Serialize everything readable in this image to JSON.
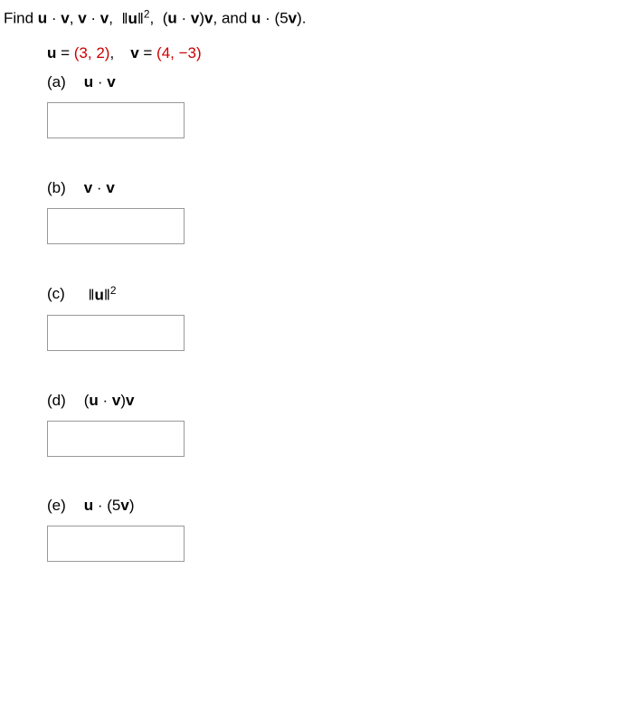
{
  "intro": {
    "prefix": "Find ",
    "e1_a": "u",
    "dot": " · ",
    "e1_b": "v",
    "comma": ", ",
    "e2_a": "v",
    "e2_b": "v",
    "e3_open": "‖",
    "e3_u": "u",
    "e3_close": "‖",
    "e3_exp": "2",
    "e4_open": "(",
    "e4_u": "u",
    "e4_v1": "v",
    "e4_close": ")",
    "e4_v2": "v",
    "and": ", and ",
    "e5_u": "u",
    "e5_open": " · (5",
    "e5_v": "v",
    "e5_close": ").",
    "period": ""
  },
  "given": {
    "u_lhs": "u",
    "u_eq": " = ",
    "u_rhs": "(3, 2)",
    "sep": ",",
    "v_lhs": "v",
    "v_eq": " = ",
    "v_rhs": "(4, −3)"
  },
  "parts": {
    "a": {
      "letter": "(a)",
      "e_u": "u",
      "dot": " · ",
      "e_v": "v"
    },
    "b": {
      "letter": "(b)",
      "e_v1": "v",
      "dot": " · ",
      "e_v2": "v"
    },
    "c": {
      "letter": "(c)",
      "open": "‖",
      "u": "u",
      "close": "‖",
      "exp": "2"
    },
    "d": {
      "letter": "(d)",
      "open": "(",
      "u": "u",
      "dot": " · ",
      "v1": "v",
      "close": ")",
      "v2": "v"
    },
    "e": {
      "letter": "(e)",
      "u": "u",
      "open": " · (5",
      "v": "v",
      "close": ")"
    }
  }
}
